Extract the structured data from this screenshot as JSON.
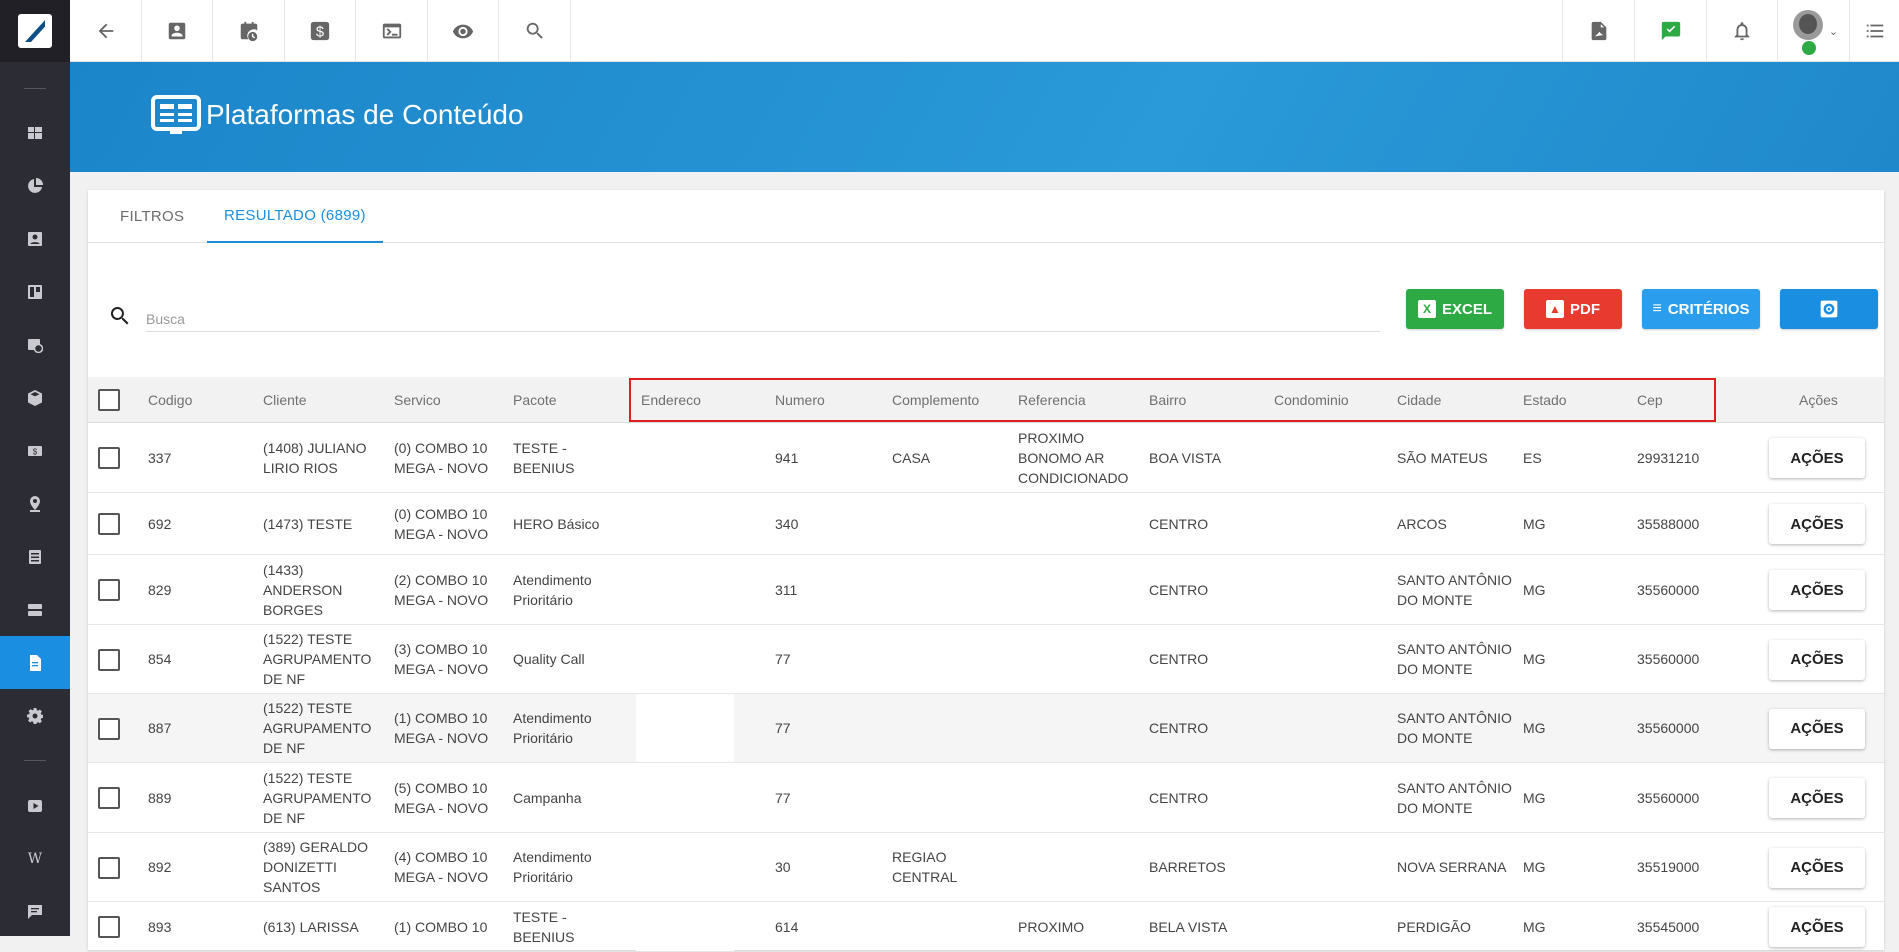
{
  "page": {
    "title": "Plataformas de Conteúdo"
  },
  "colors": {
    "accent": "#1a8ee1",
    "excel": "#2eaa45",
    "pdf": "#e83a2f",
    "criterios": "#2a9ded",
    "settings": "#1a8ee1",
    "highlight": "#e01e1e"
  },
  "sidebar": {
    "items": [
      {
        "icon": "dashboard-icon"
      },
      {
        "icon": "pie-chart-icon"
      },
      {
        "icon": "contact-card-icon"
      },
      {
        "icon": "board-icon"
      },
      {
        "icon": "calendar-clock-icon"
      },
      {
        "icon": "box-icon"
      },
      {
        "icon": "money-icon"
      },
      {
        "icon": "map-pin-icon"
      },
      {
        "icon": "document-list-icon"
      },
      {
        "icon": "server-icon"
      },
      {
        "icon": "file-icon",
        "active": true
      },
      {
        "icon": "gear-icon"
      },
      {
        "icon": "video-icon"
      },
      {
        "icon": "wiki-icon",
        "label": "W"
      },
      {
        "icon": "chat-icon"
      }
    ]
  },
  "topbar": {
    "left_icons": [
      "back-arrow-icon",
      "contact-icon",
      "calendar-clock-icon",
      "dollar-icon",
      "terminal-icon",
      "eye-icon",
      "search-icon"
    ],
    "right_icons": [
      "pdf-icon",
      "chat-check-icon",
      "bell-icon",
      "avatar",
      "list-icon"
    ]
  },
  "tabs": [
    {
      "label": "FILTROS",
      "active": false
    },
    {
      "label": "RESULTADO (6899)",
      "active": true
    }
  ],
  "search": {
    "placeholder": "Busca"
  },
  "buttons": {
    "excel": "EXCEL",
    "pdf": "PDF",
    "criterios": "CRITÉRIOS"
  },
  "table": {
    "headers": {
      "codigo": "Codigo",
      "cliente": "Cliente",
      "servico": "Servico",
      "pacote": "Pacote",
      "endereco": "Endereco",
      "numero": "Numero",
      "complemento": "Complemento",
      "referencia": "Referencia",
      "bairro": "Bairro",
      "condominio": "Condominio",
      "cidade": "Cidade",
      "estado": "Estado",
      "cep": "Cep",
      "acoes": "Ações"
    },
    "action_label": "AÇÕES",
    "rows": [
      {
        "codigo": "337",
        "cliente": "(1408) JULIANO LIRIO RIOS",
        "servico": "(0) COMBO 10 MEGA - NOVO",
        "pacote": "TESTE - BEENIUS",
        "endereco": "",
        "numero": "941",
        "complemento": "CASA",
        "referencia": "PROXIMO BONOMO AR CONDICIONADO",
        "bairro": "BOA VISTA",
        "condominio": "",
        "cidade": "SÃO MATEUS",
        "estado": "ES",
        "cep": "29931210"
      },
      {
        "codigo": "692",
        "cliente": "(1473) TESTE",
        "servico": "(0) COMBO 10 MEGA - NOVO",
        "pacote": "HERO Básico",
        "endereco": "",
        "numero": "340",
        "complemento": "",
        "referencia": "",
        "bairro": "CENTRO",
        "condominio": "",
        "cidade": "ARCOS",
        "estado": "MG",
        "cep": "35588000"
      },
      {
        "codigo": "829",
        "cliente": "(1433) ANDERSON BORGES",
        "servico": "(2) COMBO 10 MEGA - NOVO",
        "pacote": "Atendimento Prioritário",
        "endereco": "",
        "numero": "311",
        "complemento": "",
        "referencia": "",
        "bairro": "CENTRO",
        "condominio": "",
        "cidade": "SANTO ANTÔNIO DO MONTE",
        "estado": "MG",
        "cep": "35560000"
      },
      {
        "codigo": "854",
        "cliente": "(1522) TESTE AGRUPAMENTO DE NF",
        "servico": "(3) COMBO 10 MEGA - NOVO",
        "pacote": "Quality Call",
        "endereco": "",
        "numero": "77",
        "complemento": "",
        "referencia": "",
        "bairro": "CENTRO",
        "condominio": "",
        "cidade": "SANTO ANTÔNIO DO MONTE",
        "estado": "MG",
        "cep": "35560000"
      },
      {
        "codigo": "887",
        "cliente": "(1522) TESTE AGRUPAMENTO DE NF",
        "servico": "(1) COMBO 10 MEGA - NOVO",
        "pacote": "Atendimento Prioritário",
        "endereco": "",
        "numero": "77",
        "complemento": "",
        "referencia": "",
        "bairro": "CENTRO",
        "condominio": "",
        "cidade": "SANTO ANTÔNIO DO MONTE",
        "estado": "MG",
        "cep": "35560000"
      },
      {
        "codigo": "889",
        "cliente": "(1522) TESTE AGRUPAMENTO DE NF",
        "servico": "(5) COMBO 10 MEGA - NOVO",
        "pacote": "Campanha",
        "endereco": "",
        "numero": "77",
        "complemento": "",
        "referencia": "",
        "bairro": "CENTRO",
        "condominio": "",
        "cidade": "SANTO ANTÔNIO DO MONTE",
        "estado": "MG",
        "cep": "35560000"
      },
      {
        "codigo": "892",
        "cliente": "(389) GERALDO DONIZETTI SANTOS",
        "servico": "(4) COMBO 10 MEGA - NOVO",
        "pacote": "Atendimento Prioritário",
        "endereco": "",
        "numero": "30",
        "complemento": "REGIAO CENTRAL",
        "referencia": "",
        "bairro": "BARRETOS",
        "condominio": "",
        "cidade": "NOVA SERRANA",
        "estado": "MG",
        "cep": "35519000"
      },
      {
        "codigo": "893",
        "cliente": "(613) LARISSA",
        "servico": "(1) COMBO 10",
        "pacote": "TESTE - BEENIUS",
        "endereco": "",
        "numero": "614",
        "complemento": "",
        "referencia": "PROXIMO",
        "bairro": "BELA VISTA",
        "condominio": "",
        "cidade": "PERDIGÃO",
        "estado": "MG",
        "cep": "35545000"
      }
    ]
  }
}
